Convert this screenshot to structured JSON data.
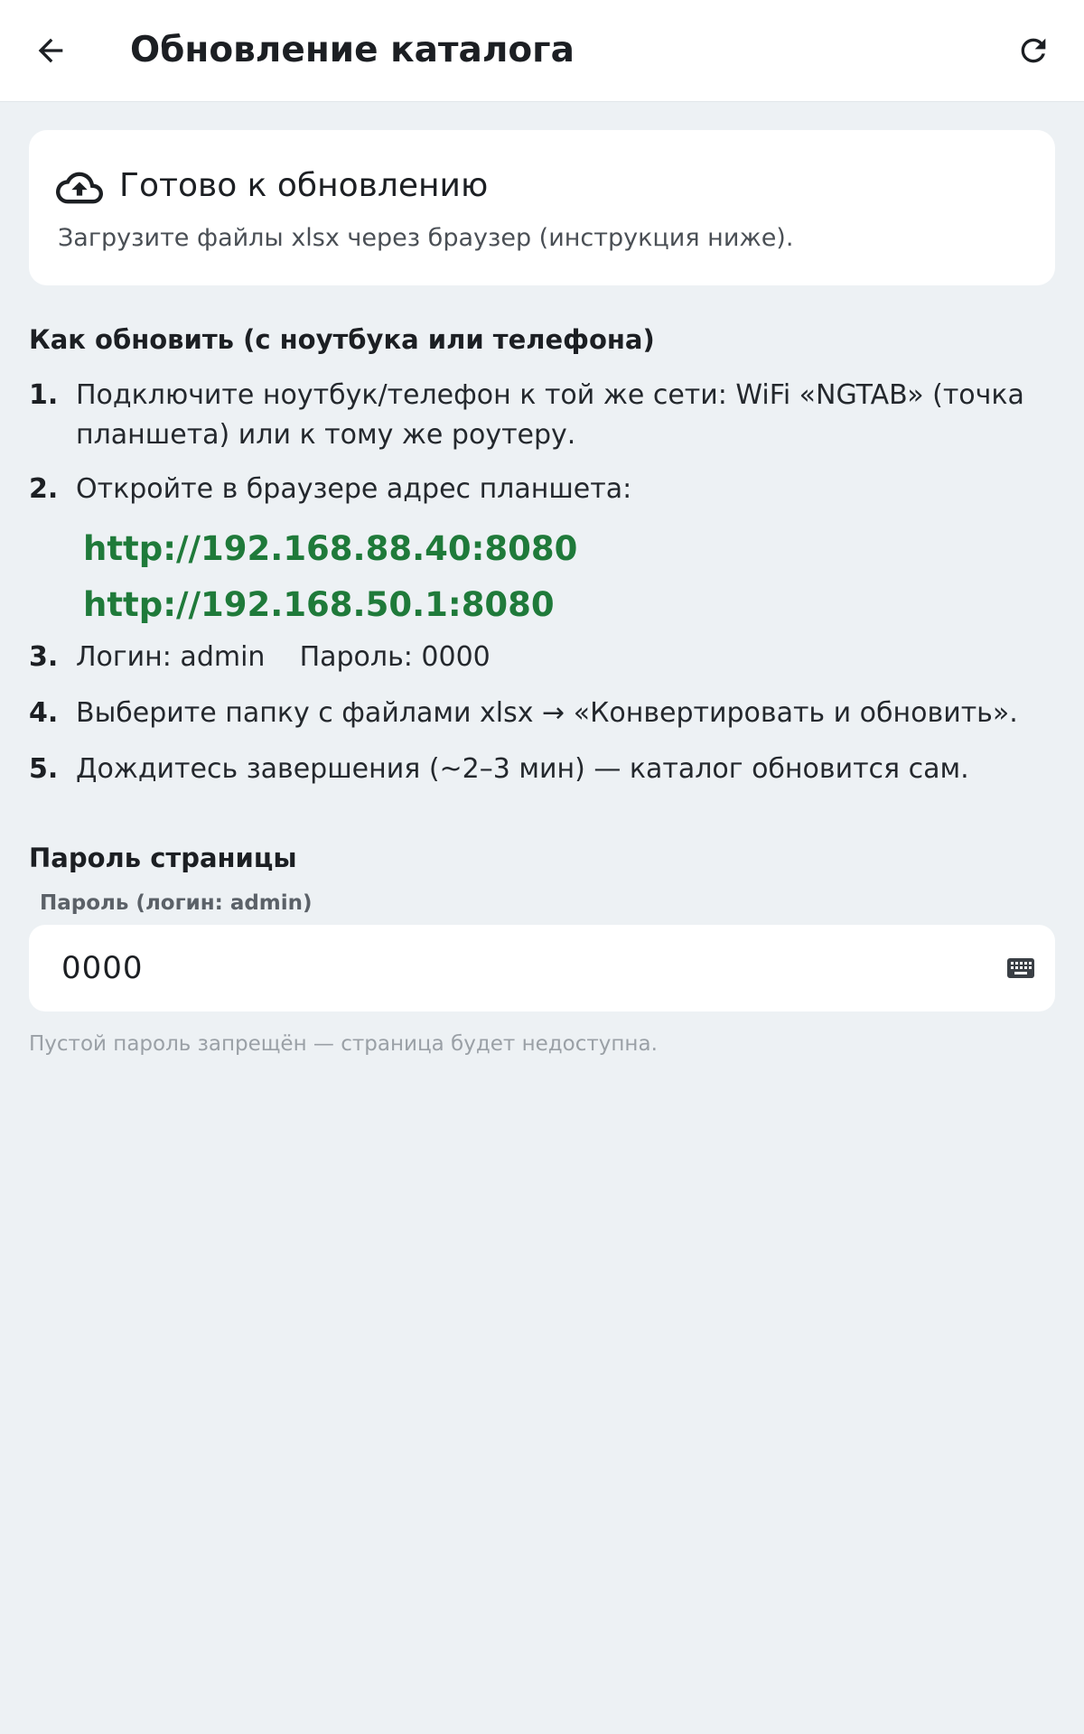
{
  "app_bar": {
    "title": "Обновление каталога",
    "back_icon": "arrow-back-icon",
    "refresh_icon": "refresh-icon"
  },
  "status_card": {
    "icon": "cloud-upload-icon",
    "title": "Готово к обновлению",
    "subtitle": "Загрузите файлы xlsx через браузер (инструкция ниже)."
  },
  "instructions": {
    "heading": "Как обновить (с ноутбука или телефона)",
    "steps": [
      {
        "num": "1.",
        "text": "Подключите ноутбук/телефон к той же сети: WiFi «NGTAB» (точка планшета) или к тому же роутеру."
      },
      {
        "num": "2.",
        "text": "Откройте в браузере адрес планшета:"
      },
      {
        "num": "3.",
        "text": "Логин: admin    Пароль: 0000"
      },
      {
        "num": "4.",
        "text": "Выберите папку с файлами xlsx → «Конвертировать и обновить»."
      },
      {
        "num": "5.",
        "text": "Дождитесь завершения (~2–3 мин) — каталог обновится сам."
      }
    ],
    "urls": [
      "http://192.168.88.40:8080",
      "http://192.168.50.1:8080"
    ]
  },
  "password_section": {
    "heading": "Пароль страницы",
    "field_label": "Пароль (логин: admin)",
    "field_value": "0000",
    "keyboard_icon": "keyboard-icon",
    "hint": "Пустой пароль запрещён — страница будет недоступна."
  },
  "colors": {
    "background": "#edf1f4",
    "surface": "#ffffff",
    "link_green": "#1f7a3a",
    "hint_gray": "#9aa0a6"
  }
}
